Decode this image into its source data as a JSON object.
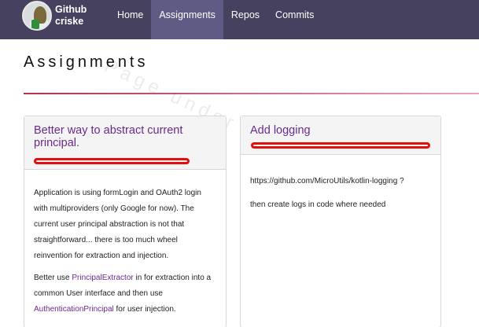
{
  "navbar": {
    "brand_line1": "Github",
    "brand_line2": "criske",
    "avatar_icon": "user-avatar-icon",
    "items": [
      {
        "label": "Home",
        "active": false
      },
      {
        "label": "Assignments",
        "active": true
      },
      {
        "label": "Repos",
        "active": false
      },
      {
        "label": "Commits",
        "active": false
      }
    ]
  },
  "page": {
    "title": "Assignments",
    "watermark": "Page under construction"
  },
  "cards": [
    {
      "title": "Better way to abstract current principal.",
      "paragraph1": "Application is using formLogin and OAuth2 login with multiproviders (only Google for now). The current user principal abstraction is not that straightforward... there is too much wheel reinvention for extraction and injection.",
      "p2_before": "Better use ",
      "p2_link1": "PrincipalExtractor",
      "p2_middle": " in for extraction into a common User interface and then use ",
      "p2_link2": "AuthenticationPrincipal",
      "p2_after": " for user injection."
    },
    {
      "title": "Add logging",
      "line1": "https://github.com/MicroUtils/kotlin-logging ?",
      "line2": "then create logs in code where needed"
    }
  ],
  "colors": {
    "navbar_bg": "#45415f",
    "active_nav_bg": "#5f5b85",
    "card_title": "#6a2a8a",
    "rule": "#b43050",
    "redaction": "#e01010"
  }
}
